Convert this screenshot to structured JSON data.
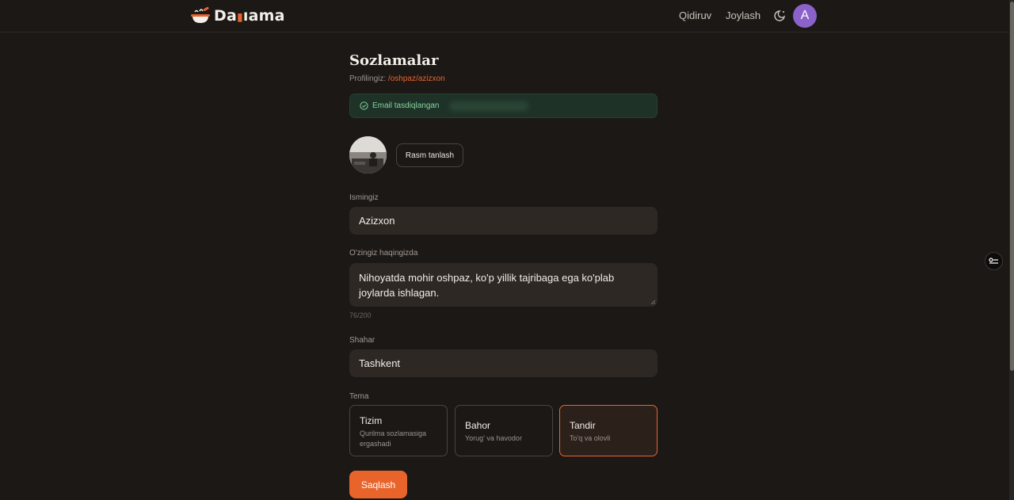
{
  "header": {
    "logo_text_1": "Da",
    "logo_text_2": "ama",
    "nav_search": "Qidiruv",
    "nav_post": "Joylash",
    "avatar_initial": "A"
  },
  "page": {
    "title": "Sozlamalar",
    "profile_label": "Profilingiz:",
    "profile_link": "/oshpaz/azizxon"
  },
  "email_banner": {
    "text": "Email tasdiqlangan"
  },
  "photo": {
    "button_label": "Rasm tanlash"
  },
  "form": {
    "name_label": "Ismingiz",
    "name_value": "Azizxon",
    "bio_label": "O'zingiz haqingizda",
    "bio_value": "Nihoyatda mohir oshpaz, ko'p yillik tajribaga ega ko'plab joylarda ishlagan.",
    "bio_counter": "76/200",
    "city_label": "Shahar",
    "city_value": "Tashkent"
  },
  "theme": {
    "label": "Tema",
    "options": [
      {
        "name": "Tizim",
        "desc": "Qurilma sozlamasiga ergashadi"
      },
      {
        "name": "Bahor",
        "desc": "Yorug' va havodor"
      },
      {
        "name": "Tandir",
        "desc": "To'q va olovli"
      }
    ],
    "selected": "Tandir"
  },
  "save_label": "Saqlash",
  "colors": {
    "background": "#1c1816",
    "accent": "#e8642b",
    "field": "#2e2825",
    "success": "#86d39f",
    "avatar": "#8b62c9"
  }
}
